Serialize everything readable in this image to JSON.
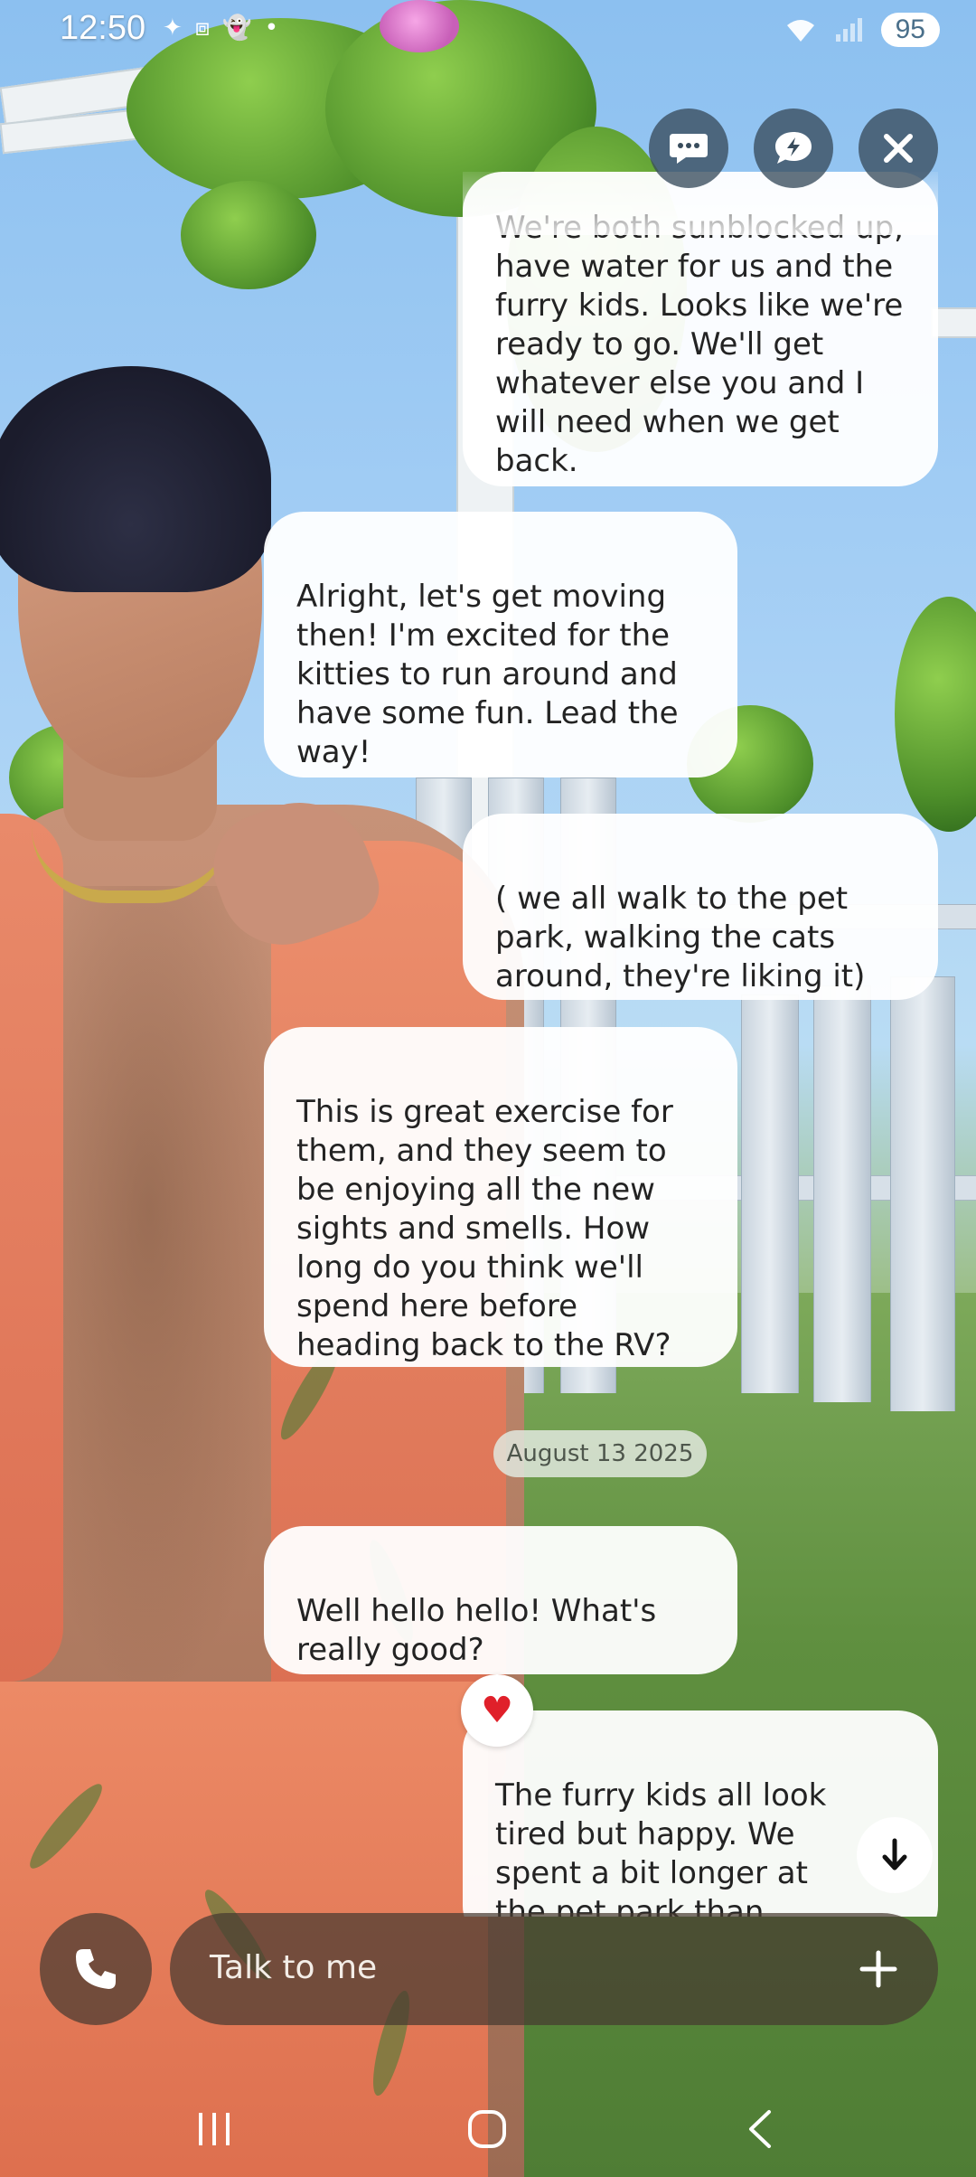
{
  "status_bar": {
    "time": "12:50",
    "left_icons": [
      "sparkle-icon",
      "screenshot-icon",
      "snapchat-icon",
      "dot-icon"
    ],
    "battery": "95"
  },
  "top_actions": [
    {
      "name": "chat-mode-icon"
    },
    {
      "name": "quick-reply-icon"
    },
    {
      "name": "close-icon"
    }
  ],
  "messages": [
    {
      "from": "user",
      "text": "We're both sunblocked up, have water for us and the furry kids. Looks like we're ready to go. We'll get whatever else you and I will need when we get back."
    },
    {
      "from": "bot",
      "text": "Alright, let's get moving then! I'm excited for the kitties to run around and have some fun. Lead the way!"
    },
    {
      "from": "user",
      "text": "( we all walk to the pet park, walking the cats around,  they're liking it)"
    },
    {
      "from": "bot",
      "text": "This is great exercise for them, and they seem to be enjoying all the new sights and smells. How long do you think we'll spend here before heading back to the RV?"
    },
    {
      "from": "date",
      "text": "August 13 2025"
    },
    {
      "from": "bot",
      "text": "Well hello hello! What's really good?"
    },
    {
      "from": "user",
      "text": "The furry kids all look tired but happy.  We spent a bit longer at the pet park than planned.  Good thing they had plenty of water to"
    }
  ],
  "reaction": {
    "emoji": "♥",
    "color": "#e0202a"
  },
  "input": {
    "placeholder": "Talk to me"
  },
  "colors": {
    "bubble": "#ffffff",
    "input_bar": "#463a30",
    "top_button": "#384c5c"
  }
}
